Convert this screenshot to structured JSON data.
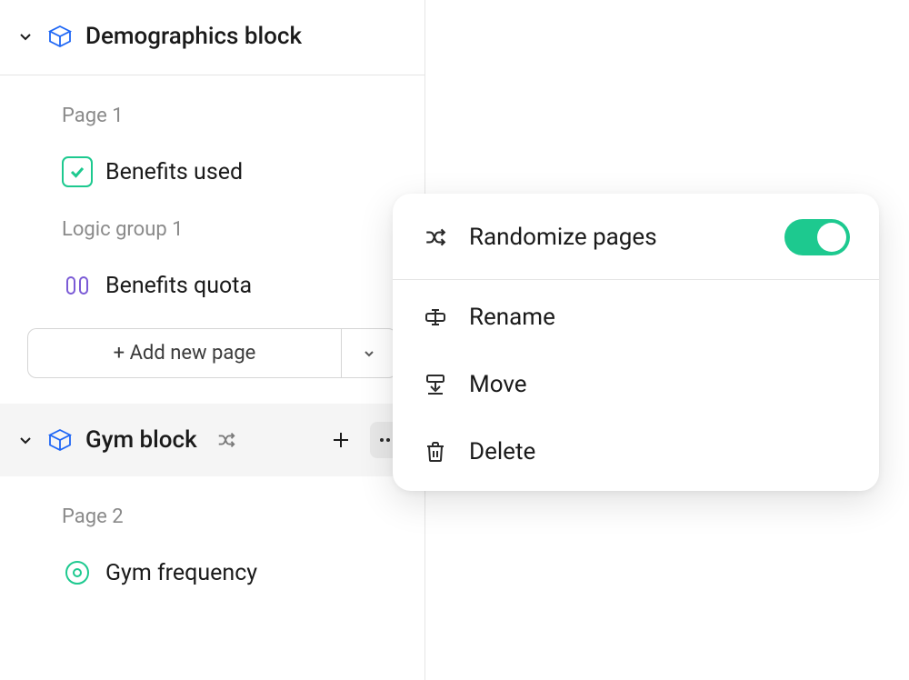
{
  "blocks": {
    "demographics": {
      "title": "Demographics block",
      "page1_label": "Page 1",
      "benefits_used": "Benefits used",
      "logic_group_label": "Logic group 1",
      "benefits_quota": "Benefits quota",
      "add_page": "+ Add new page"
    },
    "gym": {
      "title": "Gym block",
      "page2_label": "Page 2",
      "gym_frequency": "Gym frequency"
    }
  },
  "menu": {
    "randomize": "Randomize pages",
    "rename": "Rename",
    "move": "Move",
    "delete": "Delete",
    "randomize_on": true
  }
}
